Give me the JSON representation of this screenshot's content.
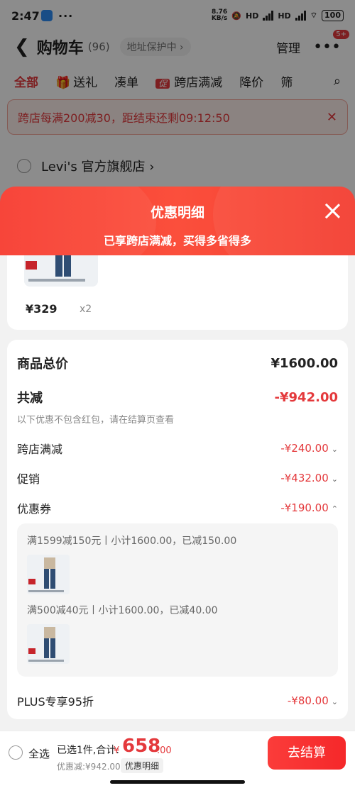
{
  "status_bar": {
    "time": "2:47",
    "more": "···",
    "speed": "8.76\nKB/s",
    "network_1": "HD",
    "network_2": "HD",
    "battery": "100"
  },
  "nav": {
    "back": "❮",
    "title": "购物车",
    "count": "(96)",
    "address": "地址保护中 ›",
    "manage": "管理",
    "more_icon": "•••",
    "badge": "5+"
  },
  "tabs": {
    "all": "全部",
    "gift": "送礼",
    "bundle": "凑单",
    "tag": "促",
    "cross_store": "跨店满减",
    "price_drop": "降价",
    "filter": "筛"
  },
  "promo_banner": {
    "text": "跨店每满200减30，距结束还剩09:12:50",
    "close": "✕"
  },
  "store": {
    "name": "Levi's 官方旗舰店 ›"
  },
  "sheet": {
    "title": "优惠明细",
    "subtitle": "已享跨店满减，买得多省得多"
  },
  "product": {
    "price": "¥329",
    "qty": "x2"
  },
  "details": {
    "total_label": "商品总价",
    "total_value": "¥1600.00",
    "reduce_label": "共减",
    "reduce_value": "-¥942.00",
    "note": "以下优惠不包含红包，请在结算页查看",
    "items": [
      {
        "label": "跨店满减",
        "value": "-¥240.00",
        "caret": "⌄"
      },
      {
        "label": "促销",
        "value": "-¥432.00",
        "caret": "⌄"
      },
      {
        "label": "优惠券",
        "value": "-¥190.00",
        "caret": "⌃"
      }
    ],
    "coupons": [
      {
        "text": "满1599减150元丨小计1600.00，已减150.00"
      },
      {
        "text": "满500减40元丨小计1600.00，已减40.00"
      }
    ],
    "plus_label": "PLUS专享95折",
    "plus_value": "-¥80.00",
    "plus_caret": "⌄"
  },
  "bottom_bar": {
    "select_all": "全选",
    "selected": "已选1件,合计:",
    "currency": "¥",
    "amount": "658",
    "cents": ".00",
    "discount": "优惠减:¥942.00",
    "detail_link": "优惠明细",
    "checkout": "去结算"
  },
  "colors": {
    "accent": "#e4393c",
    "header_red": "#f73a2e"
  }
}
